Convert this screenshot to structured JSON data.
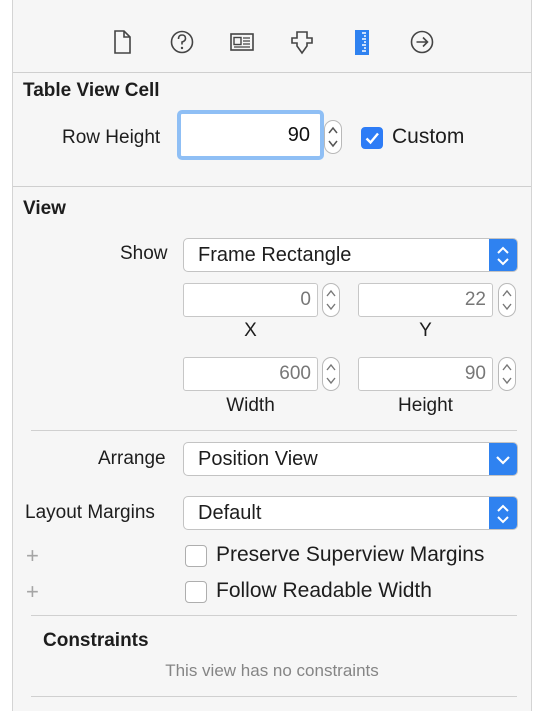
{
  "toolbar": {
    "icons": [
      "file-icon",
      "help-icon",
      "identity-icon",
      "attributes-icon",
      "size-icon",
      "connections-icon"
    ],
    "active": "size-icon",
    "accent": "#2f82f0"
  },
  "table_view_cell": {
    "title": "Table View Cell",
    "row_height_label": "Row Height",
    "row_height_value": "90",
    "custom_label": "Custom",
    "custom_checked": true
  },
  "view": {
    "title": "View",
    "show_label": "Show",
    "show_value": "Frame Rectangle",
    "x_value": "0",
    "x_label": "X",
    "y_value": "22",
    "y_label": "Y",
    "width_value": "600",
    "width_label": "Width",
    "height_value": "90",
    "height_label": "Height",
    "arrange_label": "Arrange",
    "arrange_value": "Position View",
    "layout_margins_label": "Layout Margins",
    "layout_margins_value": "Default",
    "preserve_label": "Preserve Superview Margins",
    "preserve_checked": false,
    "readable_label": "Follow Readable Width",
    "readable_checked": false,
    "plus_symbol": "+"
  },
  "constraints": {
    "title": "Constraints",
    "empty_text": "This view has no constraints"
  }
}
